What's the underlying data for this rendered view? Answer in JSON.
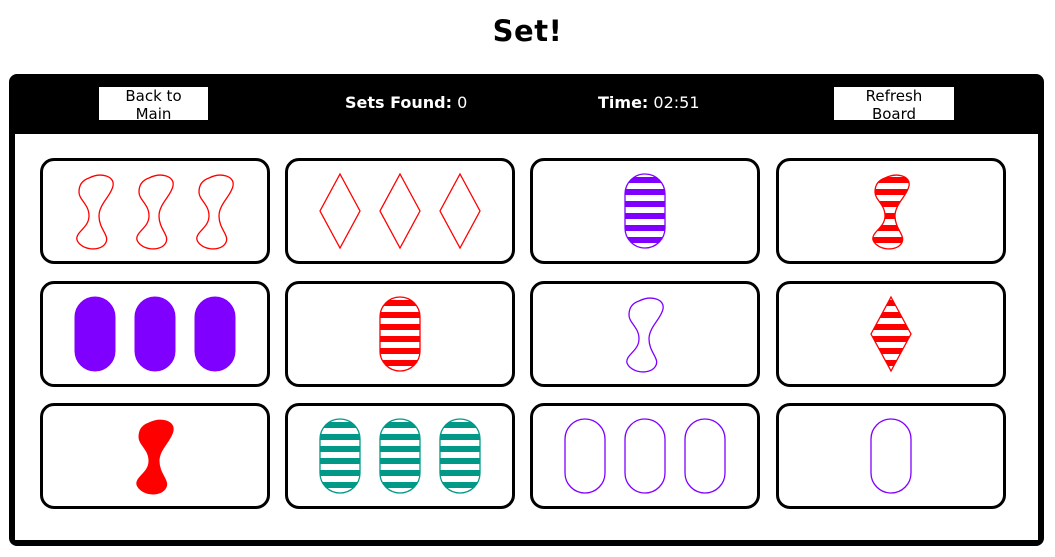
{
  "title": "Set!",
  "toolbar": {
    "back_label": "Back to Main",
    "sets_found_label": "Sets Found:",
    "sets_found_value": "0",
    "time_label": "Time:",
    "time_value": "02:51",
    "refresh_label": "Refresh Board"
  },
  "colors": {
    "red": "#ff0000",
    "purple": "#8000ff",
    "green": "#009988"
  },
  "cards": [
    {
      "count": 3,
      "shape": "squiggle",
      "fill": "empty",
      "color": "red"
    },
    {
      "count": 3,
      "shape": "diamond",
      "fill": "empty",
      "color": "red"
    },
    {
      "count": 1,
      "shape": "oval",
      "fill": "striped",
      "color": "purple"
    },
    {
      "count": 1,
      "shape": "squiggle",
      "fill": "striped",
      "color": "red"
    },
    {
      "count": 3,
      "shape": "oval",
      "fill": "solid",
      "color": "purple"
    },
    {
      "count": 1,
      "shape": "oval",
      "fill": "striped",
      "color": "red"
    },
    {
      "count": 1,
      "shape": "squiggle",
      "fill": "empty",
      "color": "purple"
    },
    {
      "count": 1,
      "shape": "diamond",
      "fill": "striped",
      "color": "red"
    },
    {
      "count": 1,
      "shape": "squiggle",
      "fill": "solid",
      "color": "red"
    },
    {
      "count": 3,
      "shape": "oval",
      "fill": "striped",
      "color": "green"
    },
    {
      "count": 3,
      "shape": "oval",
      "fill": "empty",
      "color": "purple"
    },
    {
      "count": 1,
      "shape": "oval",
      "fill": "empty",
      "color": "purple"
    }
  ]
}
